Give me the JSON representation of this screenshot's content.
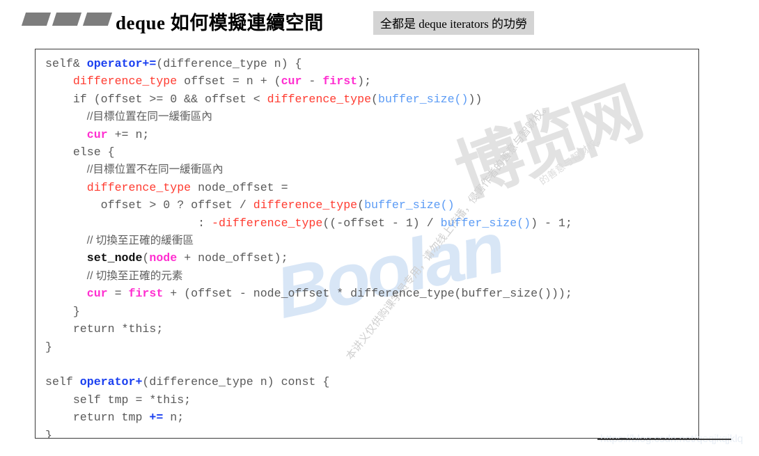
{
  "header": {
    "title": "deque 如何模擬連續空間",
    "badge": "全都是 deque iterators 的功勞",
    "marks_count": 3
  },
  "code": {
    "language": "C++",
    "lines": [
      [
        {
          "t": "self& ",
          "c": "plain"
        },
        {
          "t": "operator+=",
          "c": "kw"
        },
        {
          "t": "(difference_type n) {",
          "c": "plain"
        }
      ],
      [
        {
          "t": "    ",
          "c": "plain"
        },
        {
          "t": "difference_type",
          "c": "type"
        },
        {
          "t": " offset = n + (",
          "c": "plain"
        },
        {
          "t": "cur",
          "c": "member"
        },
        {
          "t": " - ",
          "c": "plain"
        },
        {
          "t": "first",
          "c": "member"
        },
        {
          "t": ");",
          "c": "plain"
        }
      ],
      [
        {
          "t": "    if (offset >= 0 && offset < ",
          "c": "plain"
        },
        {
          "t": "difference_type",
          "c": "type"
        },
        {
          "t": "(",
          "c": "plain"
        },
        {
          "t": "buffer_size()",
          "c": "fn"
        },
        {
          "t": "))",
          "c": "plain"
        }
      ],
      [
        {
          "t": "      ",
          "c": "plain"
        },
        {
          "t": "//目標位置在同一緩衝區內",
          "c": "cmt"
        }
      ],
      [
        {
          "t": "      ",
          "c": "plain"
        },
        {
          "t": "cur",
          "c": "member"
        },
        {
          "t": " += n;",
          "c": "plain"
        }
      ],
      [
        {
          "t": "    else {",
          "c": "plain"
        }
      ],
      [
        {
          "t": "      ",
          "c": "plain"
        },
        {
          "t": "//目標位置不在同一緩衝區內",
          "c": "cmt"
        }
      ],
      [
        {
          "t": "      ",
          "c": "plain"
        },
        {
          "t": "difference_type",
          "c": "type"
        },
        {
          "t": " node_offset =",
          "c": "plain"
        }
      ],
      [
        {
          "t": "        offset > 0 ? offset / ",
          "c": "plain"
        },
        {
          "t": "difference_type",
          "c": "type"
        },
        {
          "t": "(",
          "c": "plain"
        },
        {
          "t": "buffer_size()",
          "c": "fn"
        }
      ],
      [
        {
          "t": "                      : ",
          "c": "plain"
        },
        {
          "t": "-difference_type",
          "c": "type"
        },
        {
          "t": "((-offset - 1) / ",
          "c": "plain"
        },
        {
          "t": "buffer_size()",
          "c": "fn"
        },
        {
          "t": ") - 1;",
          "c": "plain"
        }
      ],
      [
        {
          "t": "      ",
          "c": "plain"
        },
        {
          "t": "// 切換至正確的緩衝區",
          "c": "cmt"
        }
      ],
      [
        {
          "t": "      ",
          "c": "plain"
        },
        {
          "t": "set_node",
          "c": "bold"
        },
        {
          "t": "(",
          "c": "plain"
        },
        {
          "t": "node",
          "c": "member"
        },
        {
          "t": " + node_offset);",
          "c": "plain"
        }
      ],
      [
        {
          "t": "      ",
          "c": "plain"
        },
        {
          "t": "// 切換至正確的元素",
          "c": "cmt"
        }
      ],
      [
        {
          "t": "      ",
          "c": "plain"
        },
        {
          "t": "cur",
          "c": "member"
        },
        {
          "t": " = ",
          "c": "plain"
        },
        {
          "t": "first",
          "c": "member"
        },
        {
          "t": " + (offset - node_offset * difference_type(buffer_size()));",
          "c": "plain"
        }
      ],
      [
        {
          "t": "    }",
          "c": "plain"
        }
      ],
      [
        {
          "t": "    return *this;",
          "c": "plain"
        }
      ],
      [
        {
          "t": "}",
          "c": "plain"
        }
      ],
      [
        {
          "t": "",
          "c": "plain"
        }
      ],
      [
        {
          "t": "self ",
          "c": "plain"
        },
        {
          "t": "operator+",
          "c": "kw"
        },
        {
          "t": "(difference_type n) const {",
          "c": "plain"
        }
      ],
      [
        {
          "t": "    self tmp = *this;",
          "c": "plain"
        }
      ],
      [
        {
          "t": "    return tmp ",
          "c": "plain"
        },
        {
          "t": "+=",
          "c": "kw"
        },
        {
          "t": " n;",
          "c": "plain"
        }
      ],
      [
        {
          "t": "}",
          "c": "plain"
        }
      ]
    ]
  },
  "watermarks": {
    "boolan": "Boolan",
    "bolanwang": "博览网",
    "notice_1": "本讲义仅供购课学员专用，请勿线上传播，侵害作者的善意与智财权。",
    "notice_2": "的善意与智财权。",
    "footer_url": "https://blog.csdn.net/qeqjkqjklq"
  },
  "colors": {
    "keyword": "#1a3ff0",
    "type": "#ff3b30",
    "member": "#ff2fd0",
    "function": "#5b9bf5",
    "comment": "#5e5e5e",
    "plain": "#595959",
    "badge_bg": "#d4d4d4",
    "mark": "#7d7d7d",
    "border": "#3a3a3a"
  }
}
